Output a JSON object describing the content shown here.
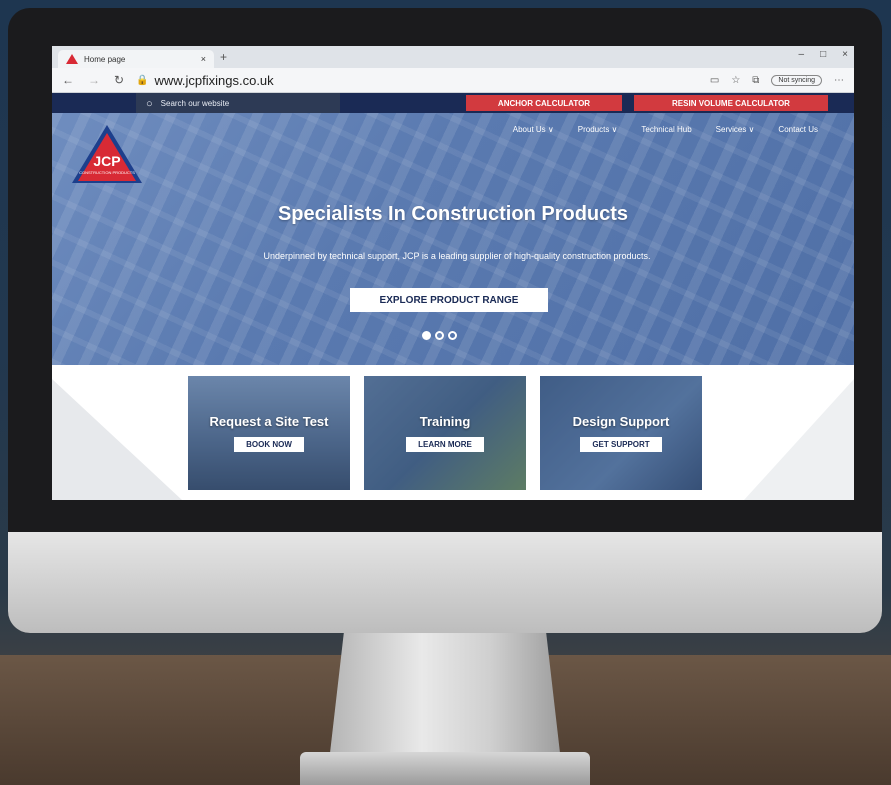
{
  "browser": {
    "tab_title": "Home page",
    "tab_close": "×",
    "new_tab": "+",
    "win_minimize": "–",
    "win_maximize": "□",
    "win_close": "×",
    "url": "www.jcpfixings.co.uk",
    "sync_label": "Not syncing"
  },
  "site": {
    "search_placeholder": "Search our website",
    "anchor_calculator": "ANCHOR CALCULATOR",
    "resin_calculator": "RESIN VOLUME CALCULATOR",
    "logo_text": "JCP",
    "logo_sub": "CONSTRUCTION PRODUCTS",
    "nav": [
      {
        "label": "About Us ∨"
      },
      {
        "label": "Products ∨"
      },
      {
        "label": "Technical Hub"
      },
      {
        "label": "Services ∨"
      },
      {
        "label": "Contact Us"
      }
    ],
    "hero": {
      "title": "Specialists In Construction Products",
      "subtitle": "Underpinned by technical support, JCP is a leading supplier of high-quality construction products.",
      "button": "EXPLORE PRODUCT RANGE",
      "slides_total": 3,
      "active_slide": 1
    },
    "cards": [
      {
        "title": "Request a Site Test",
        "button": "BOOK NOW"
      },
      {
        "title": "Training",
        "button": "LEARN MORE"
      },
      {
        "title": "Design Support",
        "button": "GET SUPPORT"
      }
    ]
  },
  "colors": {
    "navy": "#1a2a55",
    "red": "#d23a3f",
    "hero_blue": "#5a7ab0"
  }
}
